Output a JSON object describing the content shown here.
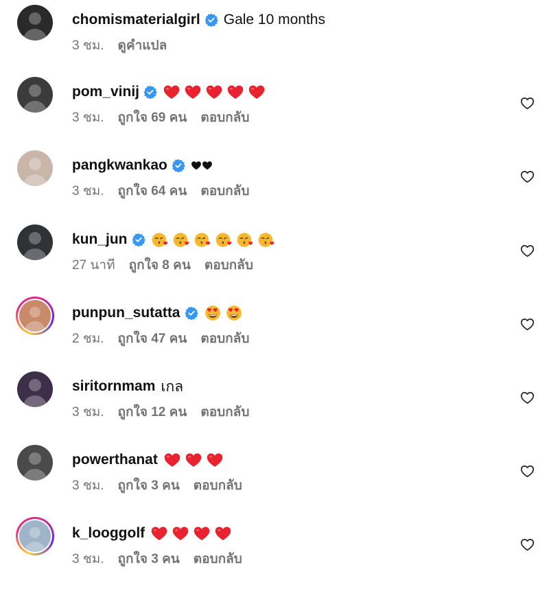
{
  "comments": [
    {
      "username": "chomismaterialgirl",
      "verified": true,
      "text": "Gale 10 months",
      "emoji": "",
      "emoji_count": 0,
      "time": "3 ชม.",
      "likes": "",
      "action": "ดูคำแปล",
      "story": false,
      "like_button": false,
      "avatar_color": "#2a2a2a"
    },
    {
      "username": "pom_vinij",
      "verified": true,
      "text": "",
      "emoji": "red-heart",
      "emoji_count": 5,
      "time": "3 ชม.",
      "likes": "ถูกใจ 69 คน",
      "action": "ตอบกลับ",
      "story": false,
      "like_button": true,
      "avatar_color": "#3b3b3b"
    },
    {
      "username": "pangkwankao",
      "verified": true,
      "text": "",
      "emoji": "black-heart",
      "emoji_count": 2,
      "time": "3 ชม.",
      "likes": "ถูกใจ 64 คน",
      "action": "ตอบกลับ",
      "story": false,
      "like_button": true,
      "avatar_color": "#c9b5aa"
    },
    {
      "username": "kun_jun",
      "verified": true,
      "text": "",
      "emoji": "kissing-face",
      "emoji_count": 6,
      "time": "27 นาที",
      "likes": "ถูกใจ 8 คน",
      "action": "ตอบกลับ",
      "story": false,
      "like_button": true,
      "avatar_color": "#2f3338"
    },
    {
      "username": "punpun_sutatta",
      "verified": true,
      "text": "",
      "emoji": "heart-eyes",
      "emoji_count": 2,
      "time": "2 ชม.",
      "likes": "ถูกใจ 47 คน",
      "action": "ตอบกลับ",
      "story": true,
      "like_button": true,
      "avatar_color": "#c98a6a"
    },
    {
      "username": "siritornmam",
      "verified": false,
      "text": "เกล",
      "emoji": "",
      "emoji_count": 0,
      "time": "3 ชม.",
      "likes": "ถูกใจ 12 คน",
      "action": "ตอบกลับ",
      "story": false,
      "like_button": true,
      "avatar_color": "#3d2f4a"
    },
    {
      "username": "powerthanat",
      "verified": false,
      "text": "",
      "emoji": "red-heart",
      "emoji_count": 3,
      "time": "3 ชม.",
      "likes": "ถูกใจ 3 คน",
      "action": "ตอบกลับ",
      "story": false,
      "like_button": true,
      "avatar_color": "#4a4a4a"
    },
    {
      "username": "k_looggolf",
      "verified": false,
      "text": "",
      "emoji": "red-heart",
      "emoji_count": 4,
      "time": "3 ชม.",
      "likes": "ถูกใจ 3 คน",
      "action": "ตอบกลับ",
      "story": true,
      "like_button": true,
      "avatar_color": "#9fb4c9"
    }
  ],
  "colors": {
    "verified": "#3897f0",
    "meta": "#737373",
    "red_heart": "#e8222e",
    "black_heart": "#111111",
    "emoji_face": "#f7b72f",
    "story_ring_start": "#f9ce34",
    "story_ring_mid": "#ee2a7b"
  },
  "icons": {
    "like": "heart-outline-icon",
    "verified": "verified-badge-icon"
  }
}
